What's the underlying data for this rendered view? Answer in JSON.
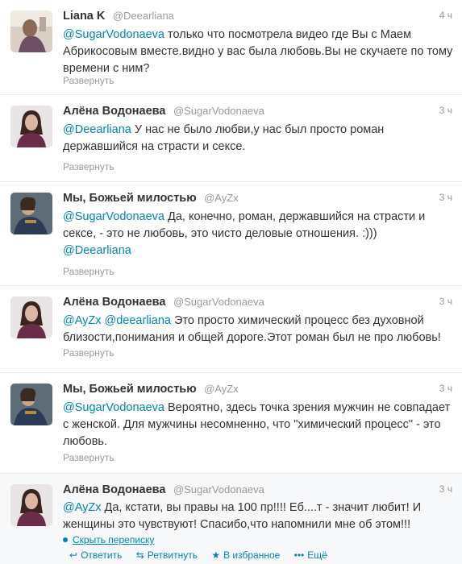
{
  "tweets": [
    {
      "name": "Liana K",
      "handle": "@Deearliana",
      "time": "4 ч",
      "mention": "@SugarVodonaeva",
      "text": " только что посмотрела видео где Вы с Маем Абрикосовым вместе.видно у вас была любовь.Вы не скучаете по тому времени с ним?",
      "expand": "Развернуть",
      "avatar": "liana-avatar"
    },
    {
      "name": "Алёна Водонаева",
      "handle": "@SugarVodonaeva",
      "time": "3 ч",
      "mention": "@Deearliana",
      "text": " У нас не было любви,у нас был просто роман державшийся на страсти и сексе.",
      "expand": "Развернуть",
      "avatar": "alena-avatar"
    },
    {
      "name": "Мы, Божьей милостью",
      "handle": "@AyZx",
      "time": "3 ч",
      "mention": "@SugarVodonaeva",
      "text": " Да, конечно, роман, державшийся на страсти и сексе, - это не любовь, это чисто деловые отношения. :)))",
      "mention_tail": "@Deearliana",
      "expand": "Развернуть",
      "avatar": "emperor-avatar"
    },
    {
      "name": "Алёна Водонаева",
      "handle": "@SugarVodonaeva",
      "time": "3 ч",
      "mention": "@AyZx @deearliana",
      "text": " Это просто химический процесс без духовной близости,понимания и общей дороге.Этот роман был не про любовь!",
      "expand": "Развернуть",
      "avatar": "alena-avatar"
    },
    {
      "name": "Мы, Божьей милостью",
      "handle": "@AyZx",
      "time": "3 ч",
      "mention": "@SugarVodonaeva",
      "text": " Вероятно, здесь точка зрения мужчин не совпадает с женской. Для мужчины несомненно, что \"химический процесс\" - это любовь.",
      "expand": "Развернуть",
      "avatar": "emperor-avatar"
    },
    {
      "name": "Алёна Водонаева",
      "handle": "@SugarVodonaeva",
      "time": "3 ч",
      "mention": "@AyZx",
      "text": " Да, кстати, вы правы на 100 пр!!!! Еб....т - значит любит! И женщины это чувствуют! Спасибо,что напомнили мне об этом!!!",
      "avatar": "alena-avatar"
    }
  ],
  "thread": {
    "hide_label": "Скрыть переписку"
  },
  "actions": {
    "reply": "Ответить",
    "retweet": "Ретвитнуть",
    "favorite": "В избранное",
    "more": "Ещё"
  },
  "colors": {
    "link": "#0084b4",
    "muted": "#999999",
    "text": "#333333"
  }
}
